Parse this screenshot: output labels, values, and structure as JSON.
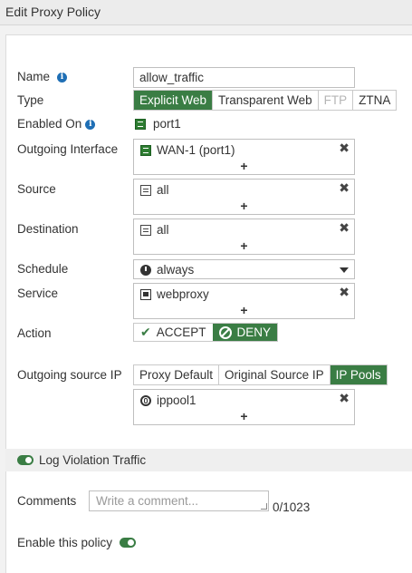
{
  "title": "Edit Proxy Policy",
  "fields": {
    "name": {
      "label": "Name",
      "value": "allow_traffic"
    },
    "type": {
      "label": "Type",
      "options": [
        "Explicit Web",
        "Transparent Web",
        "FTP",
        "ZTNA"
      ],
      "selected": "Explicit Web",
      "disabled": [
        "FTP"
      ]
    },
    "enabled_on": {
      "label": "Enabled On",
      "value": "port1",
      "icon": "port-icon"
    },
    "outgoing_interface": {
      "label": "Outgoing Interface",
      "value": "WAN-1 (port1)",
      "icon": "port-icon"
    },
    "source": {
      "label": "Source",
      "value": "all",
      "icon": "address-icon"
    },
    "destination": {
      "label": "Destination",
      "value": "all",
      "icon": "address-icon"
    },
    "schedule": {
      "label": "Schedule",
      "value": "always",
      "icon": "clock-icon"
    },
    "service": {
      "label": "Service",
      "value": "webproxy",
      "icon": "service-icon"
    },
    "action": {
      "label": "Action",
      "options": [
        "ACCEPT",
        "DENY"
      ],
      "selected": "DENY"
    },
    "outgoing_source_ip": {
      "label": "Outgoing source IP",
      "options": [
        "Proxy Default",
        "Original Source IP",
        "IP Pools"
      ],
      "selected": "IP Pools",
      "pool": "ippool1"
    }
  },
  "log_violation": {
    "label": "Log Violation Traffic",
    "enabled": true
  },
  "comments": {
    "label": "Comments",
    "placeholder": "Write a comment...",
    "counter": "0/1023"
  },
  "enable_policy": {
    "label": "Enable this policy",
    "enabled": true
  },
  "colors": {
    "accent": "#3a7d44",
    "info": "#1f6fb5"
  }
}
